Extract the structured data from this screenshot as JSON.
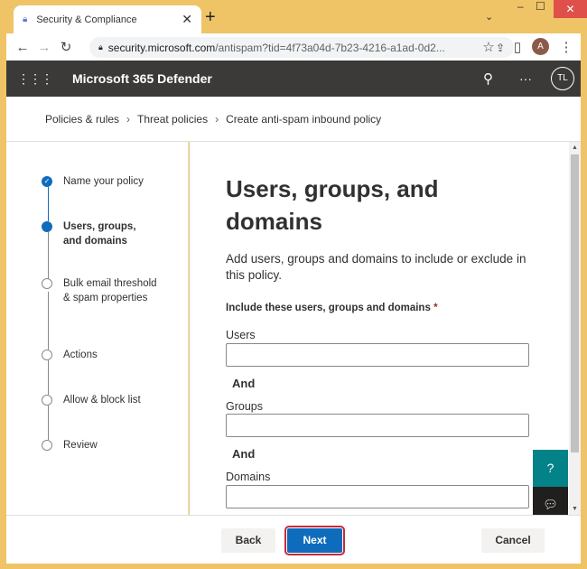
{
  "browser": {
    "tab_title": "Security & Compliance",
    "url_host": "security.microsoft.com",
    "url_path": "/antispam?tid=4f73a04d-7b23-4216-a1ad-0d2...",
    "profile_initial": "A"
  },
  "header": {
    "app_title": "Microsoft 365 Defender",
    "user_initials": "TL"
  },
  "breadcrumb": [
    "Policies & rules",
    "Threat policies",
    "Create anti-spam inbound policy"
  ],
  "steps": [
    {
      "label": "Name your policy",
      "state": "done"
    },
    {
      "label": "Users, groups, and domains",
      "state": "current"
    },
    {
      "label": "Bulk email threshold & spam properties",
      "state": "pending"
    },
    {
      "label": "Actions",
      "state": "pending"
    },
    {
      "label": "Allow & block list",
      "state": "pending"
    },
    {
      "label": "Review",
      "state": "pending"
    }
  ],
  "main": {
    "title": "Users, groups, and domains",
    "description": "Add users, groups and domains to include or exclude in this policy.",
    "include_label": "Include these users, groups and domains",
    "required_mark": "*",
    "users_label": "Users",
    "users_value": "",
    "and1": "And",
    "groups_label": "Groups",
    "groups_value": "",
    "and2": "And",
    "domains_label": "Domains",
    "domains_value": ""
  },
  "footer": {
    "back": "Back",
    "next": "Next",
    "cancel": "Cancel"
  },
  "colors": {
    "accent": "#0f6cbd",
    "header": "#3b3a39",
    "frame": "#efc466"
  }
}
